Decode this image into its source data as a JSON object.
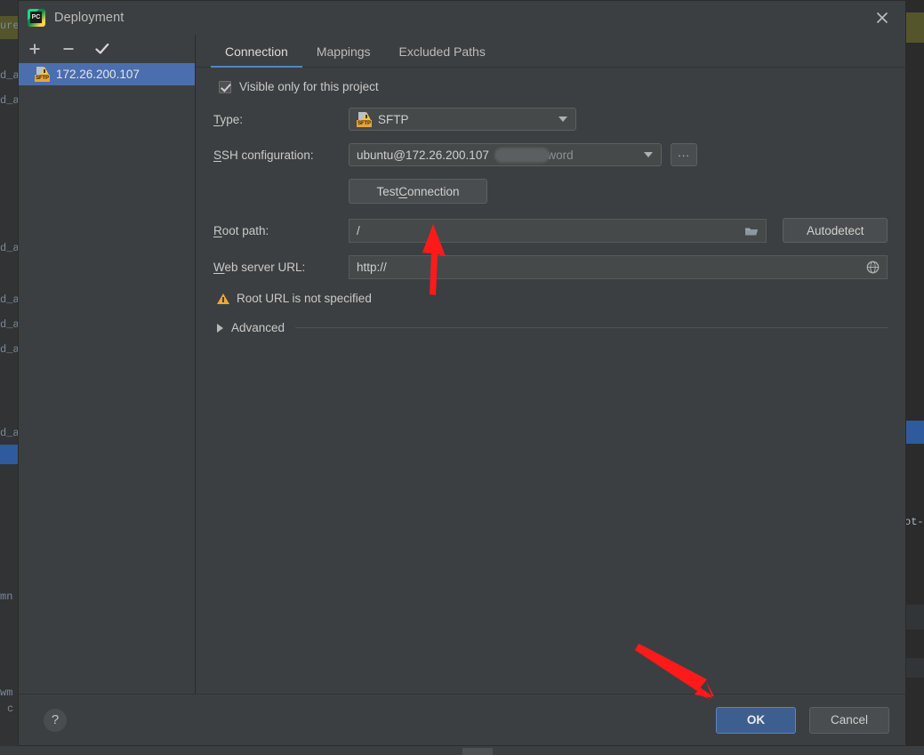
{
  "window": {
    "title": "Deployment",
    "logo_icon": "pycharm-logo-icon",
    "close_icon": "close-icon"
  },
  "left_panel": {
    "toolbar": [
      {
        "name": "add-server-button",
        "icon": "plus-icon",
        "label": "+"
      },
      {
        "name": "remove-server-button",
        "icon": "minus-icon",
        "label": "−"
      },
      {
        "name": "set-default-server-button",
        "icon": "check-icon",
        "label": "✔"
      }
    ],
    "servers": [
      {
        "name": "172.26.200.107",
        "icon": "sftp-warning-icon",
        "badge": "SFTP",
        "selected": true
      }
    ]
  },
  "tabs": [
    {
      "label": "Connection",
      "active": true
    },
    {
      "label": "Mappings",
      "active": false
    },
    {
      "label": "Excluded Paths",
      "active": false
    }
  ],
  "form": {
    "visible_only_checkbox": {
      "label": "Visible only for this project",
      "checked": true
    },
    "type": {
      "label": "Type:",
      "label_mnemonic": "T",
      "value": "SFTP",
      "icon": "sftp-icon",
      "dropdown_icon": "chevron-down-icon"
    },
    "ssh_configuration": {
      "label": "SSH configuration:",
      "label_mnemonic": "S",
      "value": "ubuntu@172.26.200.107",
      "value_suffix": "ssword",
      "redacted": true,
      "dropdown_icon": "chevron-down-icon",
      "browse_button_label": "...",
      "browse_button_name": "ssh-config-browse-button"
    },
    "test_connection": {
      "label": "Test Connection",
      "label_mnemonic": "C"
    },
    "root_path": {
      "label": "Root path:",
      "label_mnemonic": "R",
      "value": "/",
      "browse_icon": "folder-icon",
      "autodetect_label": "Autodetect"
    },
    "web_server_url": {
      "label": "Web server URL:",
      "label_mnemonic": "W",
      "value": "http://",
      "globe_icon": "globe-icon"
    },
    "warning": {
      "icon": "warning-triangle-icon",
      "text": "Root URL is not specified"
    },
    "advanced": {
      "label": "Advanced",
      "expander_icon": "triangle-right-icon",
      "expanded": false
    }
  },
  "footer": {
    "help_label": "?",
    "ok_label": "OK",
    "cancel_label": "Cancel"
  },
  "annotations": {
    "color": "#ff1a1a",
    "arrows": [
      {
        "name": "arrow-to-test-connection",
        "points_to": "Test Connection"
      },
      {
        "name": "arrow-to-ok-button",
        "points_to": "OK"
      }
    ]
  },
  "background": {
    "left_fragments": [
      "ure",
      "d_a",
      "d_a",
      "d_a",
      "d_a",
      "d_a",
      "d_a",
      "d_a",
      "mn",
      "wm",
      "c"
    ],
    "right_fragments": [
      "ot-"
    ]
  }
}
